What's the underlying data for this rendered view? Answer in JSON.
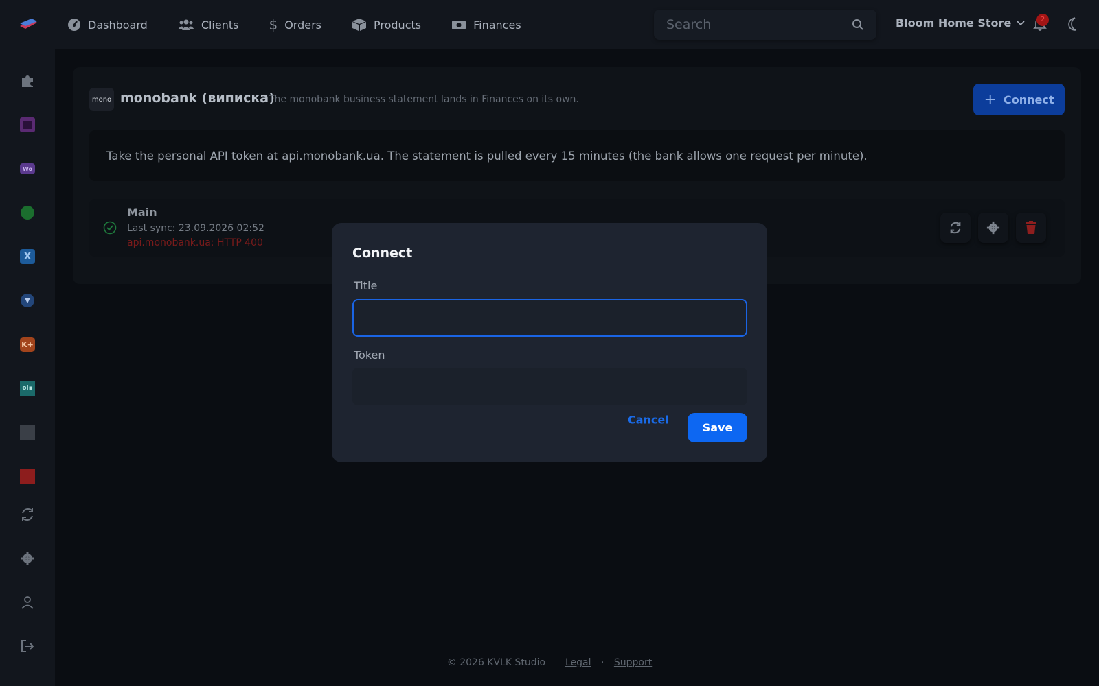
{
  "nav": {
    "items": [
      {
        "label": "Dashboard",
        "icon": "gauge-icon"
      },
      {
        "label": "Clients",
        "icon": "users-icon"
      },
      {
        "label": "Orders",
        "icon": "dollar-icon"
      },
      {
        "label": "Products",
        "icon": "box-icon"
      },
      {
        "label": "Finances",
        "icon": "money-icon"
      }
    ],
    "search_placeholder": "Search",
    "store_name": "Bloom Home Store",
    "notifications_count": "2"
  },
  "sidebar": {
    "icons": [
      "puzzle-icon",
      "square-app-icon",
      "woo-icon",
      "green-app-icon",
      "x-app-icon",
      "shield-app-icon",
      "kplus-app-icon",
      "olx-app-icon",
      "image-app-icon",
      "network-app-icon",
      "sync-icon",
      "gear-icon",
      "user-icon",
      "logout-icon"
    ]
  },
  "integration": {
    "logo_text": "mono",
    "title": "monobank (виписка)",
    "description": "The monobank business statement lands in Finances on its own.",
    "connect_label": "Connect",
    "info": "Take the personal API token at api.monobank.ua. The statement is pulled every 15 minutes (the bank allows one request per minute).",
    "account": {
      "name": "Main",
      "last_sync": "Last sync: 23.09.2026 02:52",
      "error": "api.monobank.ua: HTTP 400"
    }
  },
  "modal": {
    "title": "Connect",
    "title_label": "Title",
    "title_value": "",
    "token_label": "Token",
    "token_value": "",
    "cancel_label": "Cancel",
    "save_label": "Save"
  },
  "footer": {
    "copyright": "© 2026 KVLK Studio",
    "legal": "Legal",
    "dot": "·",
    "support": "Support"
  },
  "colors": {
    "accent": "#0d67f2",
    "danger": "#c0392b",
    "success": "#2ea44f"
  }
}
